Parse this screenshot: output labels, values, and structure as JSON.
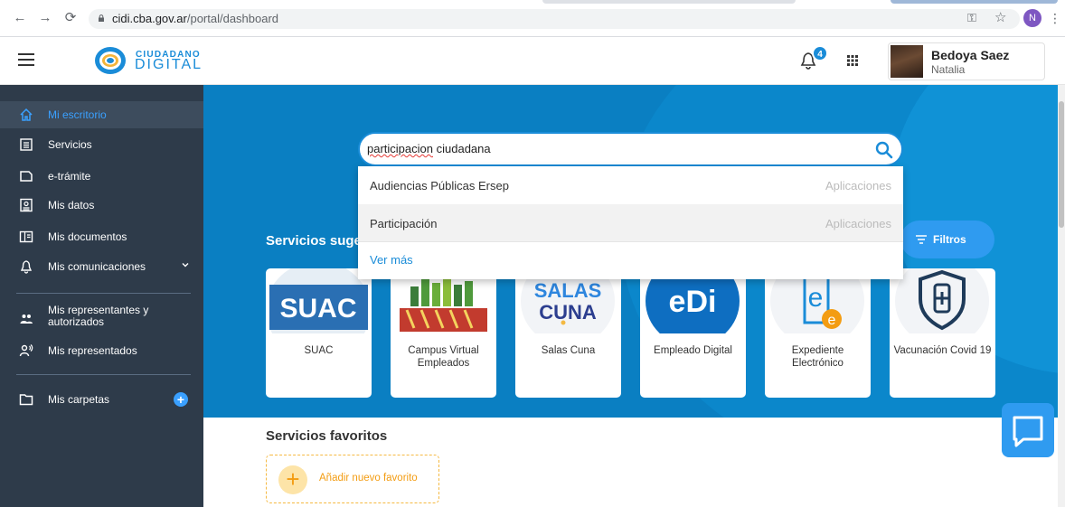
{
  "browser": {
    "url_host": "cidi.cba.gov.ar",
    "url_path": "/portal/dashboard",
    "profile_initial": "N"
  },
  "header": {
    "logo_line1": "CIUDADANO",
    "logo_line2": "DIGITAL",
    "notification_count": "4",
    "user_name": "Bedoya Saez",
    "user_subname": "Natalia"
  },
  "sidebar": {
    "items": [
      {
        "label": "Mi escritorio",
        "icon": "home-icon"
      },
      {
        "label": "Servicios",
        "icon": "list-icon"
      },
      {
        "label": "e-trámite",
        "icon": "document-icon"
      },
      {
        "label": "Mis datos",
        "icon": "id-card-icon"
      },
      {
        "label": "Mis documentos",
        "icon": "folder-split-icon"
      },
      {
        "label": "Mis comunicaciones",
        "icon": "bell-icon"
      },
      {
        "label": "Mis representantes y autorizados",
        "icon": "people-icon"
      },
      {
        "label": "Mis representados",
        "icon": "person-voice-icon"
      },
      {
        "label": "Mis carpetas",
        "icon": "folder-icon"
      }
    ]
  },
  "search": {
    "value_misspelled": "participacion",
    "value_rest": " ciudadana",
    "results": [
      {
        "label": "Audiencias Públicas Ersep",
        "category": "Aplicaciones"
      },
      {
        "label": "Participación",
        "category": "Aplicaciones"
      }
    ],
    "more_label": "Ver más"
  },
  "suggested": {
    "title": "Servicios suge",
    "filter_label": "Filtros",
    "cards": [
      {
        "caption": "SUAC",
        "logo_text": "SUAC"
      },
      {
        "caption": "Campus Virtual Empleados",
        "logo_text": ""
      },
      {
        "caption": "Salas Cuna",
        "logo_text": "SALAS CUNA"
      },
      {
        "caption": "Empleado Digital",
        "logo_text": "eDi"
      },
      {
        "caption": "Expediente Electrónico",
        "logo_text": "e"
      },
      {
        "caption": "Vacunación Covid 19",
        "logo_text": ""
      }
    ]
  },
  "favorites": {
    "title": "Servicios favoritos",
    "add_label": "Añadir nuevo favorito"
  },
  "colors": {
    "brand": "#1a8cd8",
    "sidebar_bg": "#2e3b4a",
    "hero_bg": "#0a7fc2",
    "accent_orange": "#f39c12"
  }
}
